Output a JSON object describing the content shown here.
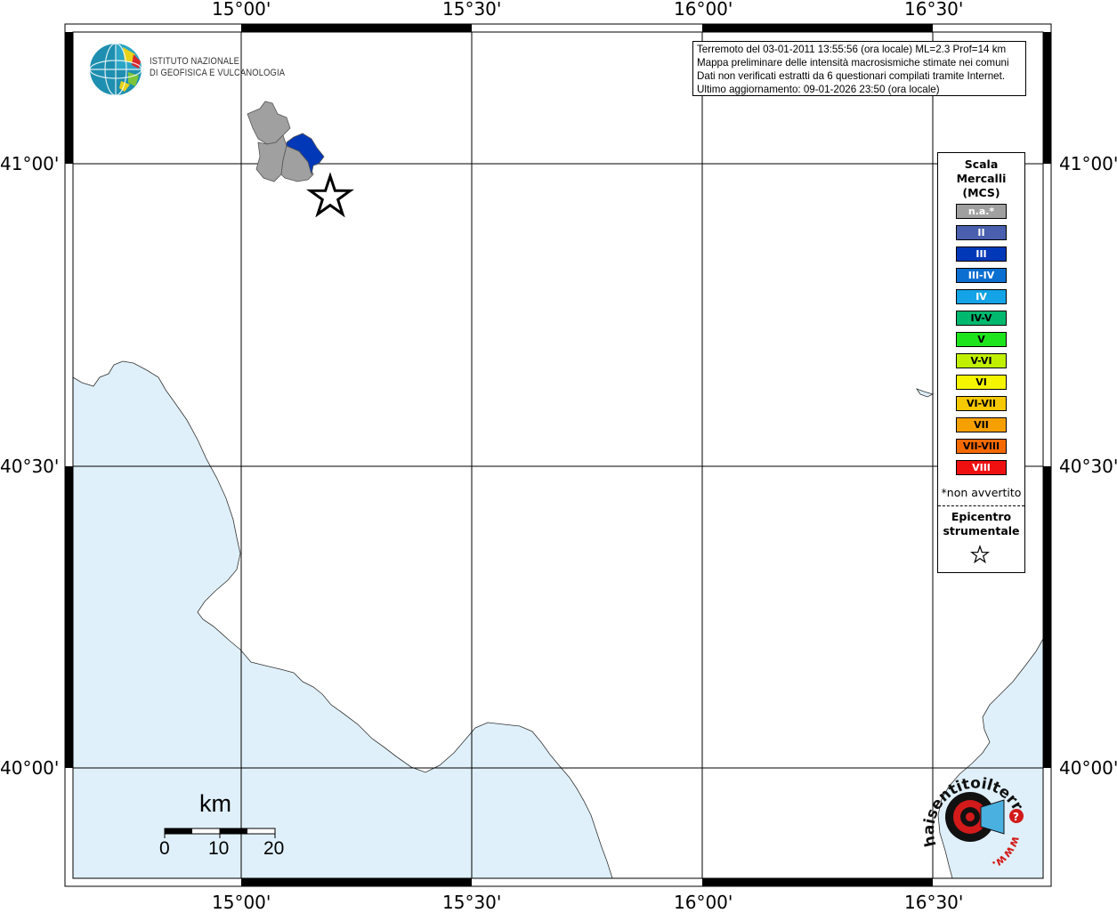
{
  "map": {
    "top_lon_labels": [
      "15°00'",
      "15°30'",
      "16°00'",
      "16°30'"
    ],
    "bottom_lon_labels": [
      "15°00'",
      "15°30'",
      "16°00'",
      "16°30'"
    ],
    "left_lat_labels": [
      "41°00'",
      "40°30'",
      "40°00'"
    ],
    "right_lat_labels": [
      "41°00'",
      "40°30'",
      "40°00'"
    ],
    "sea_color": "#dff0fa",
    "land_color": "#ffffff",
    "na_color": "#a0a0a0",
    "intensity_iii_color": "#0038b8",
    "epicenter_icon": "star-icon"
  },
  "info": {
    "line1": "Terremoto del 03-01-2011 13:55:56 (ora locale) ML=2.3 Prof=14 km",
    "line2": "Mappa preliminare delle intensità macrosismiche stimate nei comuni",
    "line3": "Dati non verificati estratti da 6 questionari compilati tramite Internet.",
    "line4": "Ultimo aggiornamento: 09-01-2026 23:50 (ora locale)"
  },
  "logo": {
    "line1": "ISTITUTO NAZIONALE",
    "line2": "DI GEOFISICA E VULCANOLOGIA"
  },
  "legend": {
    "title1": "Scala",
    "title2": "Mercalli",
    "title3": "(MCS)",
    "items": [
      {
        "label": "n.a.*",
        "color": "#a0a0a0"
      },
      {
        "label": "II",
        "color": "#4a5fae"
      },
      {
        "label": "III",
        "color": "#0038b8"
      },
      {
        "label": "III-IV",
        "color": "#0a6fd0"
      },
      {
        "label": "IV",
        "color": "#13a3e6"
      },
      {
        "label": "IV-V",
        "color": "#00b86e"
      },
      {
        "label": "V",
        "color": "#1ee41e"
      },
      {
        "label": "V-VI",
        "color": "#c0f000"
      },
      {
        "label": "VI",
        "color": "#f5f500"
      },
      {
        "label": "VI-VII",
        "color": "#f5c800"
      },
      {
        "label": "VII",
        "color": "#f5a000"
      },
      {
        "label": "VII-VIII",
        "color": "#f56a00"
      },
      {
        "label": "VIII",
        "color": "#f01010"
      }
    ],
    "note": "*non avvertito",
    "epicenter1": "Epicentro",
    "epicenter2": "strumentale"
  },
  "scalebar": {
    "unit": "km",
    "labels": [
      "0",
      "10",
      "20"
    ]
  },
  "watermark": {
    "text": "haisentitoilterremoto.it",
    "url_text": "www."
  }
}
